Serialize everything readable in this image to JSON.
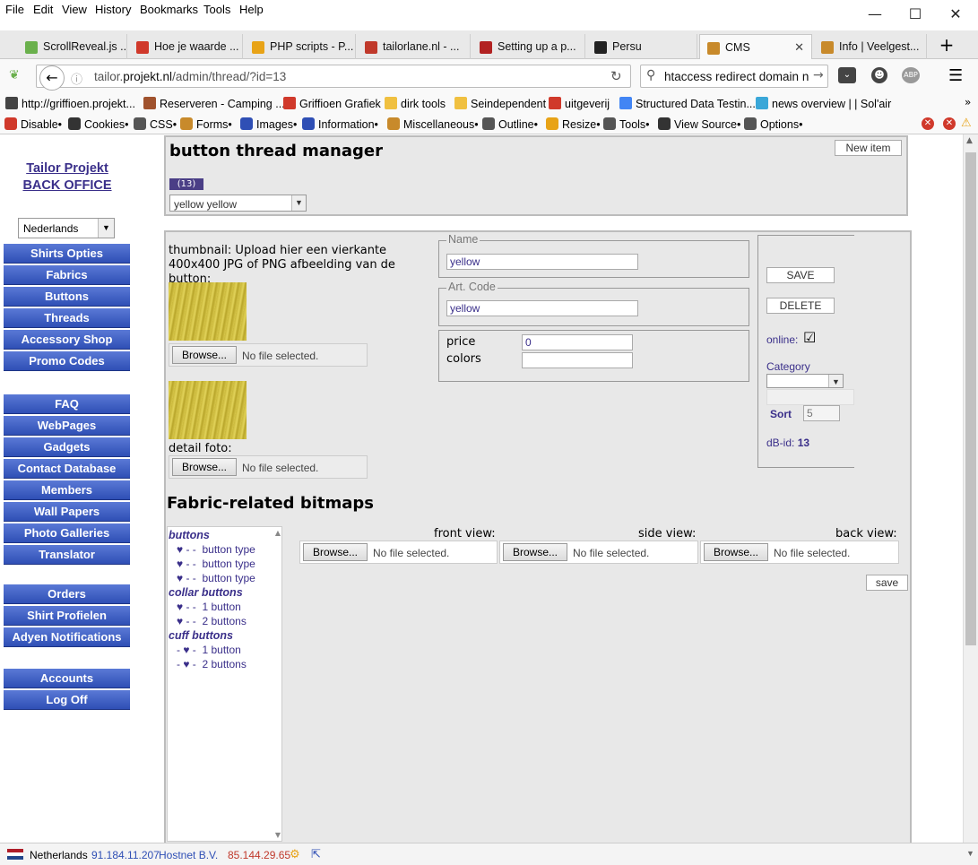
{
  "menu": {
    "file": "File",
    "edit": "Edit",
    "view": "View",
    "history": "History",
    "bookmarks": "Bookmarks",
    "tools": "Tools",
    "help": "Help"
  },
  "tabs": [
    {
      "label": "ScrollReveal.js ...",
      "color": "#6ab04c"
    },
    {
      "label": "Hoe je waarde ...",
      "color": "#d0392b"
    },
    {
      "label": "PHP scripts - P...",
      "color": "#e8a317"
    },
    {
      "label": "tailorlane.nl - ...",
      "color": "#c0392b"
    },
    {
      "label": "Setting up a p...",
      "color": "#b22222"
    },
    {
      "label": "Persu",
      "color": "#222222"
    },
    {
      "label": "CMS",
      "color": "#c88a2b"
    },
    {
      "label": "Info | Veelgest...",
      "color": "#c88a2b"
    }
  ],
  "nav": {
    "url_prefix": "tailor.",
    "url_domain": "projekt.nl",
    "url_path": "/admin/thread/?id=13",
    "search_text": "htaccess redirect domain n"
  },
  "bookmarks": [
    {
      "label": "http://griffioen.projekt...",
      "color": "#444"
    },
    {
      "label": "Reserveren - Camping ...",
      "color": "#a0522d"
    },
    {
      "label": "Griffioen Grafiek",
      "color": "#d0392b"
    },
    {
      "label": "dirk tools",
      "color": "#f0c040"
    },
    {
      "label": "Seindependent",
      "color": "#f0c040"
    },
    {
      "label": "uitgeverij",
      "color": "#d0392b"
    },
    {
      "label": "Structured Data Testin...",
      "color": "#4285f4"
    },
    {
      "label": "news overview | | Sol'air",
      "color": "#3aa7d8"
    }
  ],
  "webdev": [
    {
      "label": "Disable•"
    },
    {
      "label": "Cookies•"
    },
    {
      "label": "CSS•"
    },
    {
      "label": "Forms•"
    },
    {
      "label": "Images•"
    },
    {
      "label": "Information•"
    },
    {
      "label": "Miscellaneous•"
    },
    {
      "label": "Outline•"
    },
    {
      "label": "Resize•"
    },
    {
      "label": "Tools•"
    },
    {
      "label": "View Source•"
    },
    {
      "label": "Options•"
    }
  ],
  "sidebar": {
    "logo_line1": "Tailor Projekt",
    "logo_line2": "BACK OFFICE",
    "language": "Nederlands",
    "group1": [
      "Shirts Opties",
      "Fabrics",
      "Buttons",
      "Threads",
      "Accessory Shop",
      "Promo Codes"
    ],
    "group2": [
      "FAQ",
      "WebPages",
      "Gadgets",
      "Contact Database",
      "Members",
      "Wall Papers",
      "Photo Galleries",
      "Translator"
    ],
    "group3": [
      "Orders",
      "Shirt Profielen",
      "Adyen Notifications"
    ],
    "group4": [
      "Accounts",
      "Log Off"
    ]
  },
  "header": {
    "title": "button thread manager",
    "new_item": "New item",
    "count_badge": "(13)",
    "selected_item": "yellow yellow"
  },
  "form": {
    "thumbnail_label": "thumbnail: Upload hier een vierkante 400x400 JPG of PNG afbeelding van de button:",
    "browse": "Browse...",
    "no_file": "No file selected.",
    "detail_label": "detail foto:",
    "name_legend": "Name",
    "name_value": "yellow",
    "artcode_legend": "Art. Code",
    "artcode_value": "yellow",
    "price_label": "price",
    "price_value": "0",
    "colors_label": "colors",
    "colors_value": ""
  },
  "right": {
    "save": "SAVE",
    "delete": "DELETE",
    "online_label": "online:",
    "online_checked": "☑",
    "category_label": "Category",
    "sort_label": "Sort",
    "sort_value": "5",
    "dbid_label": "dB-id:",
    "dbid_value": "13"
  },
  "bitmaps": {
    "title": "Fabric-related bitmaps",
    "front": "front view:",
    "side": "side view:",
    "back": "back view:",
    "save": "save"
  },
  "tree": [
    {
      "category": "buttons",
      "items": [
        {
          "prefix": "♥ - -",
          "label": "button type"
        },
        {
          "prefix": "♥ - -",
          "label": "button type"
        },
        {
          "prefix": "♥ - -",
          "label": "button type"
        }
      ]
    },
    {
      "category": "collar buttons",
      "items": [
        {
          "prefix": "♥ - -",
          "label": "1 button"
        },
        {
          "prefix": "♥ - -",
          "label": "2 buttons"
        }
      ]
    },
    {
      "category": "cuff buttons",
      "items": [
        {
          "prefix": "- ♥ -",
          "label": "1 button"
        },
        {
          "prefix": "- ♥ -",
          "label": "2 buttons"
        }
      ]
    }
  ],
  "status": {
    "country": "Netherlands",
    "ip": "91.184.11.207",
    "host": "Hostnet B.V.",
    "ip2": "85.144.29.65"
  }
}
